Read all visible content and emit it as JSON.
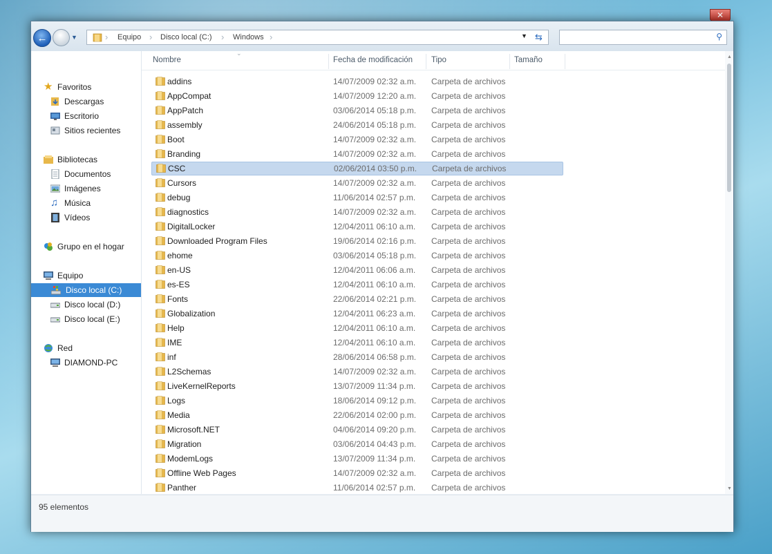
{
  "window": {
    "close_label": "✕"
  },
  "address": {
    "crumbs": [
      "Equipo",
      "Disco local (C:)",
      "Windows"
    ]
  },
  "search": {
    "placeholder": ""
  },
  "nav": {
    "favorites": {
      "label": "Favoritos",
      "items": [
        "Descargas",
        "Escritorio",
        "Sitios recientes"
      ]
    },
    "libraries": {
      "label": "Bibliotecas",
      "items": [
        "Documentos",
        "Imágenes",
        "Música",
        "Vídeos"
      ]
    },
    "homegroup": {
      "label": "Grupo en el hogar"
    },
    "computer": {
      "label": "Equipo",
      "items": [
        "Disco local (C:)",
        "Disco local (D:)",
        "Disco local (E:)"
      ]
    },
    "network": {
      "label": "Red",
      "items": [
        "DIAMOND-PC"
      ]
    }
  },
  "columns": {
    "name": "Nombre",
    "date": "Fecha de modificación",
    "type": "Tipo",
    "size": "Tamaño"
  },
  "rows": [
    {
      "name": "addins",
      "date": "14/07/2009 02:32 a.m.",
      "type": "Carpeta de archivos"
    },
    {
      "name": "AppCompat",
      "date": "14/07/2009 12:20 a.m.",
      "type": "Carpeta de archivos"
    },
    {
      "name": "AppPatch",
      "date": "03/06/2014 05:18 p.m.",
      "type": "Carpeta de archivos"
    },
    {
      "name": "assembly",
      "date": "24/06/2014 05:18 p.m.",
      "type": "Carpeta de archivos"
    },
    {
      "name": "Boot",
      "date": "14/07/2009 02:32 a.m.",
      "type": "Carpeta de archivos"
    },
    {
      "name": "Branding",
      "date": "14/07/2009 02:32 a.m.",
      "type": "Carpeta de archivos"
    },
    {
      "name": "CSC",
      "date": "02/06/2014 03:50 p.m.",
      "type": "Carpeta de archivos"
    },
    {
      "name": "Cursors",
      "date": "14/07/2009 02:32 a.m.",
      "type": "Carpeta de archivos"
    },
    {
      "name": "debug",
      "date": "11/06/2014 02:57 p.m.",
      "type": "Carpeta de archivos"
    },
    {
      "name": "diagnostics",
      "date": "14/07/2009 02:32 a.m.",
      "type": "Carpeta de archivos"
    },
    {
      "name": "DigitalLocker",
      "date": "12/04/2011 06:10 a.m.",
      "type": "Carpeta de archivos"
    },
    {
      "name": "Downloaded Program Files",
      "date": "19/06/2014 02:16 p.m.",
      "type": "Carpeta de archivos"
    },
    {
      "name": "ehome",
      "date": "03/06/2014 05:18 p.m.",
      "type": "Carpeta de archivos"
    },
    {
      "name": "en-US",
      "date": "12/04/2011 06:06 a.m.",
      "type": "Carpeta de archivos"
    },
    {
      "name": "es-ES",
      "date": "12/04/2011 06:10 a.m.",
      "type": "Carpeta de archivos"
    },
    {
      "name": "Fonts",
      "date": "22/06/2014 02:21 p.m.",
      "type": "Carpeta de archivos"
    },
    {
      "name": "Globalization",
      "date": "12/04/2011 06:23 a.m.",
      "type": "Carpeta de archivos"
    },
    {
      "name": "Help",
      "date": "12/04/2011 06:10 a.m.",
      "type": "Carpeta de archivos"
    },
    {
      "name": "IME",
      "date": "12/04/2011 06:10 a.m.",
      "type": "Carpeta de archivos"
    },
    {
      "name": "inf",
      "date": "28/06/2014 06:58 p.m.",
      "type": "Carpeta de archivos"
    },
    {
      "name": "L2Schemas",
      "date": "14/07/2009 02:32 a.m.",
      "type": "Carpeta de archivos"
    },
    {
      "name": "LiveKernelReports",
      "date": "13/07/2009 11:34 p.m.",
      "type": "Carpeta de archivos"
    },
    {
      "name": "Logs",
      "date": "18/06/2014 09:12 p.m.",
      "type": "Carpeta de archivos"
    },
    {
      "name": "Media",
      "date": "22/06/2014 02:00 p.m.",
      "type": "Carpeta de archivos"
    },
    {
      "name": "Microsoft.NET",
      "date": "04/06/2014 09:20 p.m.",
      "type": "Carpeta de archivos"
    },
    {
      "name": "Migration",
      "date": "03/06/2014 04:43 p.m.",
      "type": "Carpeta de archivos"
    },
    {
      "name": "ModemLogs",
      "date": "13/07/2009 11:34 p.m.",
      "type": "Carpeta de archivos"
    },
    {
      "name": "Offline Web Pages",
      "date": "14/07/2009 02:32 a.m.",
      "type": "Carpeta de archivos"
    },
    {
      "name": "Panther",
      "date": "11/06/2014 02:57 p.m.",
      "type": "Carpeta de archivos"
    }
  ],
  "selected_row": "CSC",
  "status": {
    "count": "95 elementos"
  },
  "colors": {
    "selection": "#c5d8ee",
    "nav_selected": "#3b8ad5",
    "folder": "#e8b84a"
  }
}
